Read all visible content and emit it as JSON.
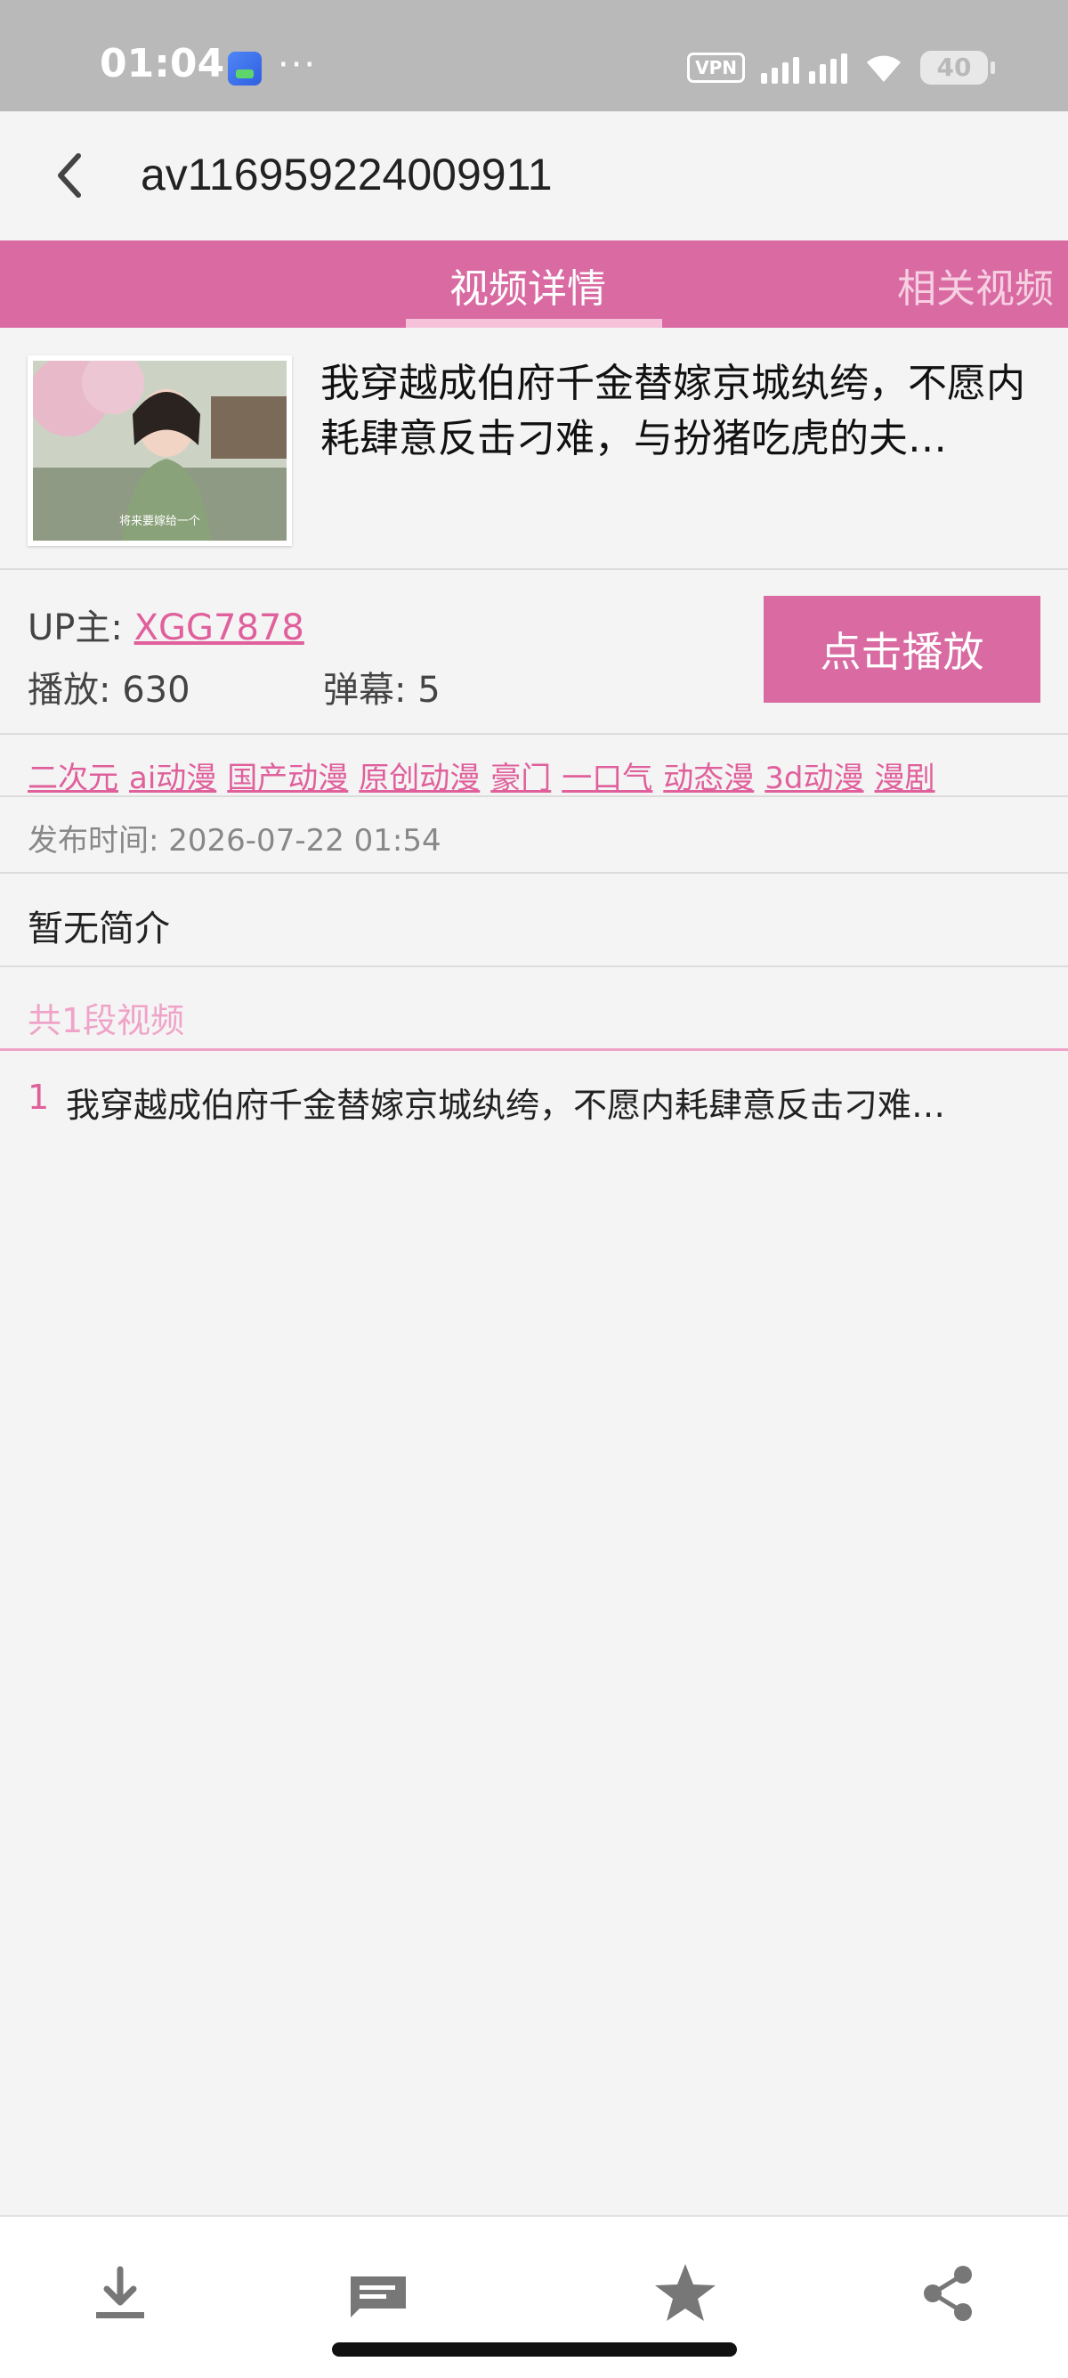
{
  "status_bar": {
    "time": "01:04",
    "more": "···",
    "vpn": "VPN",
    "battery": "40"
  },
  "header": {
    "title": "av116959224009911",
    "back_icon": "chevron-left-icon"
  },
  "tabs": [
    {
      "label": "视频详情",
      "active": true
    },
    {
      "label": "相关视频",
      "active": false
    }
  ],
  "video": {
    "title": "我穿越成伯府千金替嫁京城纨绔，不愿内耗肆意反击刁难，与扮猪吃虎的夫…",
    "thumbnail_caption": "将来要嫁给一个",
    "uploader_label": "UP主: ",
    "uploader_name": "XGG7878",
    "plays": "播放: 630",
    "danmaku": "弹幕: 5",
    "play_button": "点击播放",
    "tags": [
      "二次元",
      "ai动漫",
      "国产动漫",
      "原创动漫",
      "豪门",
      "一口气",
      "动态漫",
      "3d动漫",
      "漫剧"
    ],
    "publish_time": "发布时间: 2026-07-22 01:54",
    "description": "暂无简介",
    "segment_count": "共1段视频",
    "segments": [
      {
        "index": "1",
        "title": "我穿越成伯府千金替嫁京城纨绔，不愿内耗肆意反击刁难…"
      }
    ]
  },
  "bottom_nav": [
    {
      "icon": "download-icon"
    },
    {
      "icon": "comment-icon"
    },
    {
      "icon": "star-icon"
    },
    {
      "icon": "share-icon"
    }
  ],
  "colors": {
    "accent": "#d96ba2",
    "link": "#e0609c",
    "status_bar": "#b9b9b9"
  }
}
